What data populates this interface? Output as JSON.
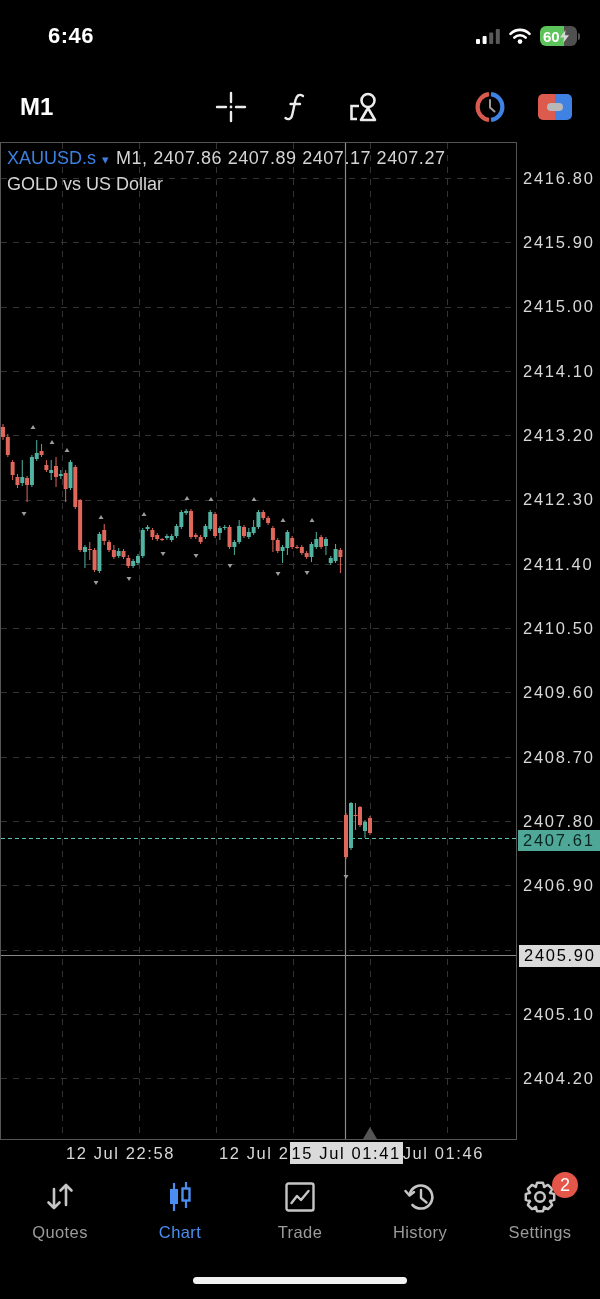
{
  "status_bar": {
    "time": "6:46",
    "battery": "60"
  },
  "toolbar": {
    "timeframe": "M1"
  },
  "chart": {
    "symbol": "XAUUSD.s",
    "symbol_menu": "▾",
    "ohlc": "M1, 2407.86 2407.89 2407.17 2407.27",
    "description": "GOLD vs US Dollar",
    "price_axis": [
      {
        "kind": "tick",
        "text": "2416.80"
      },
      {
        "kind": "tick",
        "text": "2415.90"
      },
      {
        "kind": "tick",
        "text": "2415.00"
      },
      {
        "kind": "tick",
        "text": "2414.10"
      },
      {
        "kind": "tick",
        "text": "2413.20"
      },
      {
        "kind": "tick",
        "text": "2412.30"
      },
      {
        "kind": "tick",
        "text": "2411.40"
      },
      {
        "kind": "tick",
        "text": "2410.50"
      },
      {
        "kind": "tick",
        "text": "2409.60"
      },
      {
        "kind": "tick",
        "text": "2408.70"
      },
      {
        "kind": "tick",
        "text": "2407.80"
      },
      {
        "kind": "tick",
        "text": "2406.90"
      },
      {
        "kind": "crosshair",
        "text": "2405.90"
      },
      {
        "kind": "tick",
        "text": "2405.10"
      },
      {
        "kind": "tick",
        "text": "2404.20"
      }
    ],
    "current_price": "2407.61",
    "time_axis": [
      {
        "kind": "tick",
        "text": "12 Jul 22:58"
      },
      {
        "kind": "tick",
        "text": "12 Jul 2"
      },
      {
        "kind": "crosshair",
        "text": "15 Jul 01:41"
      },
      {
        "kind": "tick",
        "text": "Jul 01:46"
      }
    ]
  },
  "tabs": [
    {
      "label": "Quotes",
      "selected": false
    },
    {
      "label": "Chart",
      "selected": true
    },
    {
      "label": "Trade",
      "selected": false
    },
    {
      "label": "History",
      "selected": false
    },
    {
      "label": "Settings",
      "selected": false,
      "badge": "2"
    }
  ]
}
